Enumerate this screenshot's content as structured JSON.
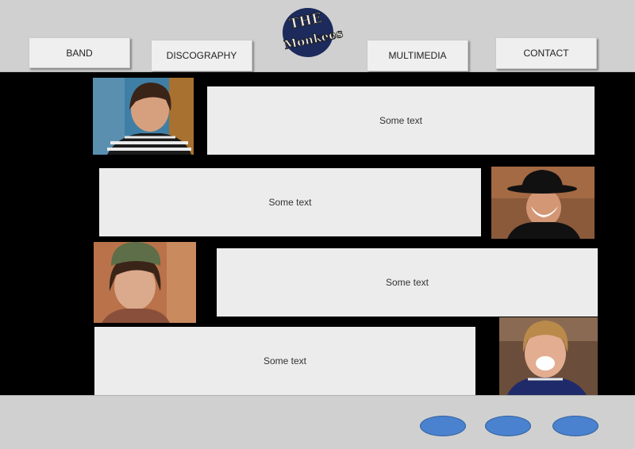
{
  "header": {
    "logo_text_top": "THE",
    "logo_text_bottom": "Monkees",
    "nav": {
      "band": "BAND",
      "discography": "DISCOGRAPHY",
      "multimedia": "MULTIMEDIA",
      "contact": "CONTACT"
    }
  },
  "members": [
    {
      "text": "Some text"
    },
    {
      "text": "Some text"
    },
    {
      "text": "Some text"
    },
    {
      "text": "Some text"
    }
  ],
  "colors": {
    "header_bg": "#d0d0d0",
    "page_bg": "#000000",
    "text_block_bg": "#ececec",
    "footer_button": "#4a82cf"
  },
  "footer": {
    "buttons": [
      "oval-button",
      "oval-button",
      "oval-button"
    ]
  }
}
